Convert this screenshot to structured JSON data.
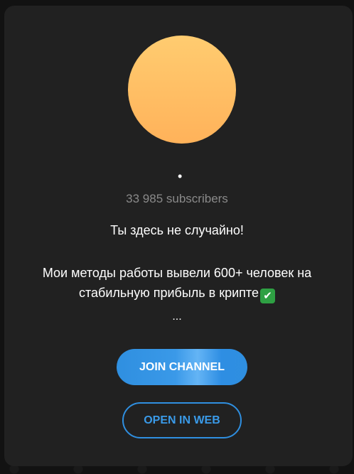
{
  "channel": {
    "avatar_gradient": [
      "#ffcc70",
      "#ffb25a"
    ],
    "title": "•",
    "subscribers": "33 985 subscribers",
    "description": {
      "line1": "Ты здесь не случайно!",
      "line2": "Мои методы работы вывели 600+ человек на",
      "line3": "стабильную прибыль в крипте",
      "emoji": "✔",
      "ellipsis": "..."
    }
  },
  "actions": {
    "join_label": "JOIN CHANNEL",
    "web_label": "OPEN IN WEB"
  },
  "colors": {
    "accent": "#2f8fe0",
    "card": "#212121",
    "background": "#121212"
  }
}
